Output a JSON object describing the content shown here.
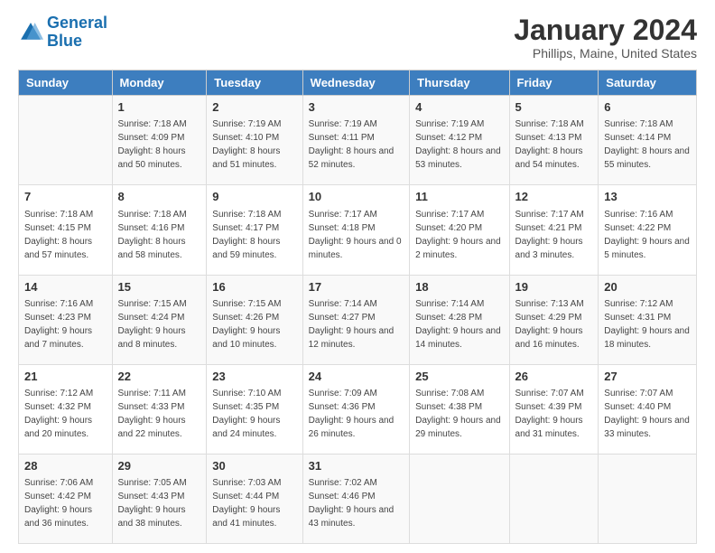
{
  "logo": {
    "line1": "General",
    "line2": "Blue"
  },
  "title": "January 2024",
  "subtitle": "Phillips, Maine, United States",
  "days_of_week": [
    "Sunday",
    "Monday",
    "Tuesday",
    "Wednesday",
    "Thursday",
    "Friday",
    "Saturday"
  ],
  "weeks": [
    [
      {
        "day": "",
        "sunrise": "",
        "sunset": "",
        "daylight": ""
      },
      {
        "day": "1",
        "sunrise": "Sunrise: 7:18 AM",
        "sunset": "Sunset: 4:09 PM",
        "daylight": "Daylight: 8 hours and 50 minutes."
      },
      {
        "day": "2",
        "sunrise": "Sunrise: 7:19 AM",
        "sunset": "Sunset: 4:10 PM",
        "daylight": "Daylight: 8 hours and 51 minutes."
      },
      {
        "day": "3",
        "sunrise": "Sunrise: 7:19 AM",
        "sunset": "Sunset: 4:11 PM",
        "daylight": "Daylight: 8 hours and 52 minutes."
      },
      {
        "day": "4",
        "sunrise": "Sunrise: 7:19 AM",
        "sunset": "Sunset: 4:12 PM",
        "daylight": "Daylight: 8 hours and 53 minutes."
      },
      {
        "day": "5",
        "sunrise": "Sunrise: 7:18 AM",
        "sunset": "Sunset: 4:13 PM",
        "daylight": "Daylight: 8 hours and 54 minutes."
      },
      {
        "day": "6",
        "sunrise": "Sunrise: 7:18 AM",
        "sunset": "Sunset: 4:14 PM",
        "daylight": "Daylight: 8 hours and 55 minutes."
      }
    ],
    [
      {
        "day": "7",
        "sunrise": "Sunrise: 7:18 AM",
        "sunset": "Sunset: 4:15 PM",
        "daylight": "Daylight: 8 hours and 57 minutes."
      },
      {
        "day": "8",
        "sunrise": "Sunrise: 7:18 AM",
        "sunset": "Sunset: 4:16 PM",
        "daylight": "Daylight: 8 hours and 58 minutes."
      },
      {
        "day": "9",
        "sunrise": "Sunrise: 7:18 AM",
        "sunset": "Sunset: 4:17 PM",
        "daylight": "Daylight: 8 hours and 59 minutes."
      },
      {
        "day": "10",
        "sunrise": "Sunrise: 7:17 AM",
        "sunset": "Sunset: 4:18 PM",
        "daylight": "Daylight: 9 hours and 0 minutes."
      },
      {
        "day": "11",
        "sunrise": "Sunrise: 7:17 AM",
        "sunset": "Sunset: 4:20 PM",
        "daylight": "Daylight: 9 hours and 2 minutes."
      },
      {
        "day": "12",
        "sunrise": "Sunrise: 7:17 AM",
        "sunset": "Sunset: 4:21 PM",
        "daylight": "Daylight: 9 hours and 3 minutes."
      },
      {
        "day": "13",
        "sunrise": "Sunrise: 7:16 AM",
        "sunset": "Sunset: 4:22 PM",
        "daylight": "Daylight: 9 hours and 5 minutes."
      }
    ],
    [
      {
        "day": "14",
        "sunrise": "Sunrise: 7:16 AM",
        "sunset": "Sunset: 4:23 PM",
        "daylight": "Daylight: 9 hours and 7 minutes."
      },
      {
        "day": "15",
        "sunrise": "Sunrise: 7:15 AM",
        "sunset": "Sunset: 4:24 PM",
        "daylight": "Daylight: 9 hours and 8 minutes."
      },
      {
        "day": "16",
        "sunrise": "Sunrise: 7:15 AM",
        "sunset": "Sunset: 4:26 PM",
        "daylight": "Daylight: 9 hours and 10 minutes."
      },
      {
        "day": "17",
        "sunrise": "Sunrise: 7:14 AM",
        "sunset": "Sunset: 4:27 PM",
        "daylight": "Daylight: 9 hours and 12 minutes."
      },
      {
        "day": "18",
        "sunrise": "Sunrise: 7:14 AM",
        "sunset": "Sunset: 4:28 PM",
        "daylight": "Daylight: 9 hours and 14 minutes."
      },
      {
        "day": "19",
        "sunrise": "Sunrise: 7:13 AM",
        "sunset": "Sunset: 4:29 PM",
        "daylight": "Daylight: 9 hours and 16 minutes."
      },
      {
        "day": "20",
        "sunrise": "Sunrise: 7:12 AM",
        "sunset": "Sunset: 4:31 PM",
        "daylight": "Daylight: 9 hours and 18 minutes."
      }
    ],
    [
      {
        "day": "21",
        "sunrise": "Sunrise: 7:12 AM",
        "sunset": "Sunset: 4:32 PM",
        "daylight": "Daylight: 9 hours and 20 minutes."
      },
      {
        "day": "22",
        "sunrise": "Sunrise: 7:11 AM",
        "sunset": "Sunset: 4:33 PM",
        "daylight": "Daylight: 9 hours and 22 minutes."
      },
      {
        "day": "23",
        "sunrise": "Sunrise: 7:10 AM",
        "sunset": "Sunset: 4:35 PM",
        "daylight": "Daylight: 9 hours and 24 minutes."
      },
      {
        "day": "24",
        "sunrise": "Sunrise: 7:09 AM",
        "sunset": "Sunset: 4:36 PM",
        "daylight": "Daylight: 9 hours and 26 minutes."
      },
      {
        "day": "25",
        "sunrise": "Sunrise: 7:08 AM",
        "sunset": "Sunset: 4:38 PM",
        "daylight": "Daylight: 9 hours and 29 minutes."
      },
      {
        "day": "26",
        "sunrise": "Sunrise: 7:07 AM",
        "sunset": "Sunset: 4:39 PM",
        "daylight": "Daylight: 9 hours and 31 minutes."
      },
      {
        "day": "27",
        "sunrise": "Sunrise: 7:07 AM",
        "sunset": "Sunset: 4:40 PM",
        "daylight": "Daylight: 9 hours and 33 minutes."
      }
    ],
    [
      {
        "day": "28",
        "sunrise": "Sunrise: 7:06 AM",
        "sunset": "Sunset: 4:42 PM",
        "daylight": "Daylight: 9 hours and 36 minutes."
      },
      {
        "day": "29",
        "sunrise": "Sunrise: 7:05 AM",
        "sunset": "Sunset: 4:43 PM",
        "daylight": "Daylight: 9 hours and 38 minutes."
      },
      {
        "day": "30",
        "sunrise": "Sunrise: 7:03 AM",
        "sunset": "Sunset: 4:44 PM",
        "daylight": "Daylight: 9 hours and 41 minutes."
      },
      {
        "day": "31",
        "sunrise": "Sunrise: 7:02 AM",
        "sunset": "Sunset: 4:46 PM",
        "daylight": "Daylight: 9 hours and 43 minutes."
      },
      {
        "day": "",
        "sunrise": "",
        "sunset": "",
        "daylight": ""
      },
      {
        "day": "",
        "sunrise": "",
        "sunset": "",
        "daylight": ""
      },
      {
        "day": "",
        "sunrise": "",
        "sunset": "",
        "daylight": ""
      }
    ]
  ]
}
